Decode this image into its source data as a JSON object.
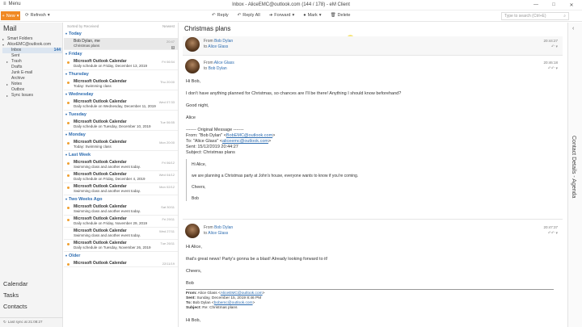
{
  "window": {
    "menu_label": "Menu",
    "title": "Inbox - AliceEMC@outlook.com (144 / 178) - eM Client",
    "controls": [
      "—",
      "□",
      "✕"
    ]
  },
  "toolbar": {
    "new_label": "New",
    "refresh_label": "Refresh",
    "reply_label": "Reply",
    "reply_all_label": "Reply All",
    "forward_label": "Forward",
    "mark_label": "Mark",
    "delete_label": "Delete",
    "search_placeholder": "Type to search (Ctrl+E)"
  },
  "sidebar": {
    "header": "Mail",
    "folders": [
      {
        "label": "Smart Folders",
        "arrow": "▸",
        "indent": 0
      },
      {
        "label": "AliceEMC@outlook.com",
        "arrow": "▾",
        "indent": 0
      },
      {
        "label": "Inbox",
        "arrow": "",
        "indent": 1,
        "count": "144",
        "selected": true
      },
      {
        "label": "Sent",
        "arrow": "",
        "indent": 1
      },
      {
        "label": "Trash",
        "arrow": "▸",
        "indent": 1
      },
      {
        "label": "Drafts",
        "arrow": "",
        "indent": 1
      },
      {
        "label": "Junk E-mail",
        "arrow": "",
        "indent": 1
      },
      {
        "label": "Archive",
        "arrow": "",
        "indent": 1
      },
      {
        "label": "Notes",
        "arrow": "▸",
        "indent": 1
      },
      {
        "label": "Outbox",
        "arrow": "",
        "indent": 1
      },
      {
        "label": "Sync Issues",
        "arrow": "▸",
        "indent": 1
      }
    ],
    "bottom_nav": [
      "Calendar",
      "Tasks",
      "Contacts"
    ],
    "last_sync": "Last sync at 21:08:27"
  },
  "message_list": {
    "sort_label": "Sorted by Received",
    "order_label": "Newest",
    "groups": [
      {
        "label": "Today",
        "messages": [
          {
            "sender": "Bob Dylan, me",
            "subject": "Christmas plans",
            "date": "20:47",
            "selected": true,
            "badge": "3",
            "unread": false
          }
        ]
      },
      {
        "label": "Friday",
        "messages": [
          {
            "sender": "Microsoft Outlook Calendar",
            "subject": "Daily schedule on Friday, December 13, 2019",
            "date": "Fri 06:54",
            "unread": true
          }
        ]
      },
      {
        "label": "Thursday",
        "messages": [
          {
            "sender": "Microsoft Outlook Calendar",
            "subject": "Today: Swimming class",
            "date": "Thu 20:00",
            "unread": true
          }
        ]
      },
      {
        "label": "Wednesday",
        "messages": [
          {
            "sender": "Microsoft Outlook Calendar",
            "subject": "Daily schedule on Wednesday, December 11, 2019",
            "date": "Wed 07:33",
            "unread": true
          }
        ]
      },
      {
        "label": "Tuesday",
        "messages": [
          {
            "sender": "Microsoft Outlook Calendar",
            "subject": "Daily schedule on Tuesday, December 10, 2019",
            "date": "Tue 06:55",
            "unread": true
          }
        ]
      },
      {
        "label": "Monday",
        "messages": [
          {
            "sender": "Microsoft Outlook Calendar",
            "subject": "Today: Swimming class",
            "date": "Mon 20:00",
            "unread": true
          }
        ]
      },
      {
        "label": "Last Week",
        "messages": [
          {
            "sender": "Microsoft Outlook Calendar",
            "subject": "Swimming class and another event today.",
            "date": "Fri 06/12",
            "unread": true
          },
          {
            "sender": "Microsoft Outlook Calendar",
            "subject": "Daily schedule on Friday, December 4, 2019",
            "date": "Wed 04/12",
            "unread": true
          },
          {
            "sender": "Microsoft Outlook Calendar",
            "subject": "Swimming class and another event today.",
            "date": "Mon 02/12",
            "unread": true
          }
        ]
      },
      {
        "label": "Two Weeks Ago",
        "messages": [
          {
            "sender": "Microsoft Outlook Calendar",
            "subject": "Swimming class and another event today.",
            "date": "Sat 30/11",
            "unread": true
          },
          {
            "sender": "Microsoft Outlook Calendar",
            "subject": "Daily schedule on Friday, November 29, 2019",
            "date": "Fri 29/11",
            "unread": true
          },
          {
            "sender": "Microsoft Outlook Calendar",
            "subject": "Swimming class and another event today.",
            "date": "Wed 27/11",
            "unread": false
          },
          {
            "sender": "Microsoft Outlook Calendar",
            "subject": "Daily schedule on Tuesday, November 26, 2019",
            "date": "Tue 26/11",
            "unread": true
          }
        ]
      },
      {
        "label": "Older",
        "messages": [
          {
            "sender": "Microsoft Outlook Calendar",
            "subject": "",
            "date": "22/11/19",
            "unread": true
          }
        ]
      }
    ]
  },
  "conversation": {
    "title": "Christmas plans",
    "messages": [
      {
        "from_prefix": "From",
        "from": "Bob Dylan",
        "to_prefix": "to",
        "to": "Alice Glass",
        "time": "20:44:27",
        "reply_icons": "↶ ▾"
      },
      {
        "from_prefix": "From",
        "from": "Alice Glass",
        "to_prefix": "to",
        "to": "Bob Dylan",
        "time": "20:46:18",
        "reply_icons": "↶↶ ▾",
        "greeting": "Hi Bob,",
        "para1": "I don't have anything planned for Christmas, so chances are I'll be there! Anything I should know beforehand?",
        "closing": "Good night,",
        "signature": "Alice",
        "orig_header": "------- Original Message -------",
        "orig_from_label": "From: \"Bob Dylan\" <",
        "orig_from_email": "BobEMC@outlook.com",
        "orig_to_label": "To: \"Alice Glass\" <",
        "orig_to_email": "aliceemc@outlook.com",
        "orig_sent": "Sent: 15/12/2019 20:44:27",
        "orig_subject": "Subject: Christmas plans",
        "quote_greeting": "Hi Alice,",
        "quote_body": "we are planning a Christmas party at John's house, everyone wants to know if you're coming.",
        "quote_closing": "Cheers,",
        "quote_sig": "Bob"
      },
      {
        "from_prefix": "From",
        "from": "Bob Dylan",
        "to_prefix": "to",
        "to": "Alice Glass",
        "time": "20:47:37",
        "reply_icons": "↶↶ ▾",
        "greeting": "Hi Alice,",
        "para1": "that's great news! Party's gonna be a blast! Already looking forward to it!",
        "closing": "Cheers,",
        "signature": "Bob",
        "hdr_from_label": "From:",
        "hdr_from_value": "Alice Glass <",
        "hdr_from_email": "AliceEMC@outlook.com",
        "hdr_sent_label": "Sent:",
        "hdr_sent_value": "Sunday, December 15, 2019 8:46 PM",
        "hdr_to_label": "To:",
        "hdr_to_value": "Bob Dylan <",
        "hdr_to_email": "bobemc@outlook.com",
        "hdr_subject_label": "Subject:",
        "hdr_subject_value": "Re: Christmas plans",
        "trailing": "Hi Bob,"
      }
    ]
  },
  "right_panel": {
    "label": "Contact Details  -  Agenda",
    "collapse_icon": "‹"
  },
  "colors": {
    "accent_orange": "#f08a24",
    "link_blue": "#2d6cb0",
    "unread_dot": "#f0a030"
  }
}
